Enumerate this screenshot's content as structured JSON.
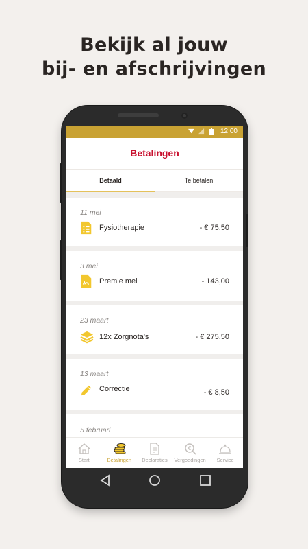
{
  "headline": {
    "line1": "Bekijk al jouw",
    "line2": "bij- en afschrijvingen"
  },
  "statusbar": {
    "time": "12:00"
  },
  "appbar": {
    "title": "Betalingen"
  },
  "tabs": [
    {
      "label": "Betaald",
      "active": true
    },
    {
      "label": "Te betalen",
      "active": false
    }
  ],
  "payments": [
    {
      "date": "11 mei",
      "icon": "document-list-icon",
      "description": "Fysiotherapie",
      "amount": "- € 75,50"
    },
    {
      "date": "3 mei",
      "icon": "document-signature-icon",
      "description": "Premie mei",
      "amount": "- 143,00"
    },
    {
      "date": "23 maart",
      "icon": "stack-layers-icon",
      "description": "12x Zorgnota's",
      "amount": "- € 275,50"
    },
    {
      "date": "13 maart",
      "icon": "pencil-icon",
      "description": "Correctie",
      "amount": "- € 8,50"
    },
    {
      "date": "5 februari"
    }
  ],
  "bottom_nav": [
    {
      "label": "Start",
      "icon": "home-icon",
      "active": false
    },
    {
      "label": "Betalingen",
      "icon": "coins-icon",
      "active": true
    },
    {
      "label": "Declaraties",
      "icon": "document-icon",
      "active": false
    },
    {
      "label": "Vergoedingen",
      "icon": "euro-search-icon",
      "active": false
    },
    {
      "label": "Service",
      "icon": "service-bell-icon",
      "active": false
    }
  ],
  "colors": {
    "accent": "#c9a233",
    "title_red": "#c8102e",
    "icon_yellow": "#f2c72e"
  }
}
